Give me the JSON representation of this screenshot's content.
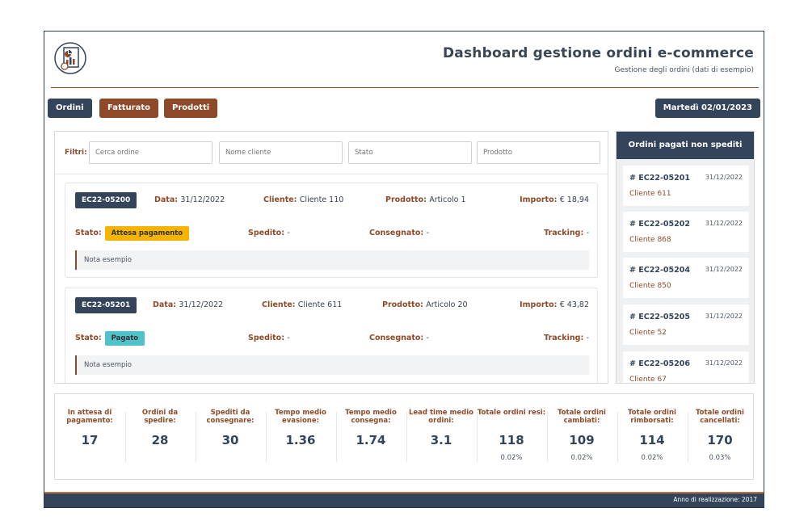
{
  "header": {
    "title": "Dashboard gestione ordini e-commerce",
    "subtitle": "Gestione degli ordini (dati di esempio)",
    "logo_icon": "report-document-icon"
  },
  "tabs": [
    {
      "label": "Ordini",
      "style": "dark"
    },
    {
      "label": "Fatturato",
      "style": "brown"
    },
    {
      "label": "Prodotti",
      "style": "brown"
    }
  ],
  "date_label": "Martedì 02/01/2023",
  "filters": {
    "label": "Filtri:",
    "search_placeholder": "Cerca ordine",
    "client_placeholder": "Nome cliente",
    "status_placeholder": "Stato",
    "product_placeholder": "Prodotto"
  },
  "orders": [
    {
      "id": "EC22-05200",
      "date_label": "Data:",
      "date": "31/12/2022",
      "client_label": "Cliente:",
      "client": "Cliente 110",
      "product_label": "Prodotto:",
      "product": "Articolo 1",
      "amount_label": "Importo:",
      "amount": "€ 18,94",
      "status_label": "Stato:",
      "status": "Attesa pagamento",
      "status_color": "#f4b400",
      "shipped_label": "Spedito:",
      "shipped": "-",
      "delivered_label": "Consegnato:",
      "delivered": "-",
      "tracking_label": "Tracking:",
      "tracking": "-",
      "note": "Nota esempio"
    },
    {
      "id": "EC22-05201",
      "date_label": "Data:",
      "date": "31/12/2022",
      "client_label": "Cliente:",
      "client": "Cliente 611",
      "product_label": "Prodotto:",
      "product": "Articolo 20",
      "amount_label": "Importo:",
      "amount": "€ 43,82",
      "status_label": "Stato:",
      "status": "Pagato",
      "status_color": "#4fc3c9",
      "shipped_label": "Spedito:",
      "shipped": "-",
      "delivered_label": "Consegnato:",
      "delivered": "-",
      "tracking_label": "Tracking:",
      "tracking": "-",
      "note": "Nota esempio"
    }
  ],
  "side": {
    "title": "Ordini pagati non spediti",
    "items": [
      {
        "id": "# EC22-05201",
        "date": "31/12/2022",
        "client": "Cliente 611"
      },
      {
        "id": "# EC22-05202",
        "date": "31/12/2022",
        "client": "Cliente 868"
      },
      {
        "id": "# EC22-05204",
        "date": "31/12/2022",
        "client": "Cliente 850"
      },
      {
        "id": "# EC22-05205",
        "date": "31/12/2022",
        "client": "Cliente 52"
      },
      {
        "id": "# EC22-05206",
        "date": "31/12/2022",
        "client": "Cliente 67"
      }
    ]
  },
  "stats": [
    {
      "label": "In attesa di pagamento:",
      "value": "17",
      "pct": ""
    },
    {
      "label": "Ordini da spedire:",
      "value": "28",
      "pct": ""
    },
    {
      "label": "Spediti da consegnare:",
      "value": "30",
      "pct": ""
    },
    {
      "label": "Tempo medio evasione:",
      "value": "1.36",
      "pct": ""
    },
    {
      "label": "Tempo medio consegna:",
      "value": "1.74",
      "pct": ""
    },
    {
      "label": "Lead time medio ordini:",
      "value": "3.1",
      "pct": ""
    },
    {
      "label": "Totale ordini resi:",
      "value": "118",
      "pct": "0.02%"
    },
    {
      "label": "Totale ordini cambiati:",
      "value": "109",
      "pct": "0.02%"
    },
    {
      "label": "Totale ordini rimborsati:",
      "value": "114",
      "pct": "0.02%"
    },
    {
      "label": "Totale ordini cancellati:",
      "value": "170",
      "pct": "0.03%"
    }
  ],
  "footer": {
    "text": "Anno di realizzazione: 2017"
  },
  "colors": {
    "primary": "#34445a",
    "accent": "#8e4a28"
  }
}
